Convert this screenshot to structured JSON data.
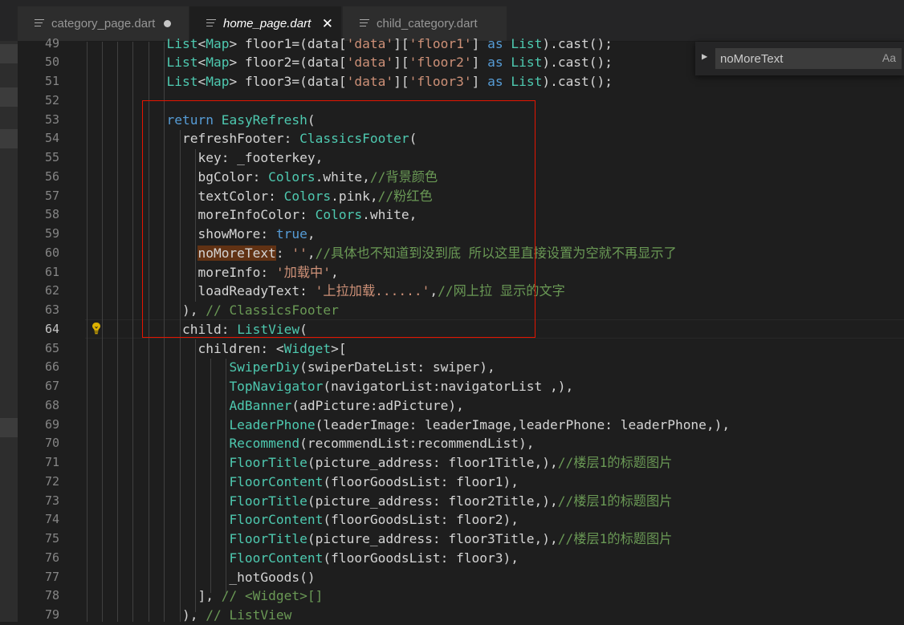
{
  "tabs": [
    {
      "label": "category_page.dart",
      "icon": "file-lines-icon",
      "dirty": true
    },
    {
      "label": "home_page.dart",
      "icon": "file-lines-icon",
      "active": true,
      "close": "✕"
    },
    {
      "label": "child_category.dart",
      "icon": "file-lines-icon"
    }
  ],
  "find_widget": {
    "value": "noMoreText",
    "match_case_label": "Aa",
    "toggle_icon": "chevron-right-icon"
  },
  "lightbulb_icon": "lightbulb-icon",
  "current_line": 64,
  "colors": {
    "keyword": "#569cd6",
    "type": "#4ec9b0",
    "string": "#ce9178",
    "comment": "#6a9955",
    "highlight": "#613214",
    "annotation_box": "#e51400"
  },
  "code": {
    "lines": [
      {
        "n": "49",
        "tokens": [
          {
            "t": "List",
            "c": "ty"
          },
          {
            "t": "<",
            "c": "id"
          },
          {
            "t": "Map",
            "c": "ty"
          },
          {
            "t": "> floor1=(data[",
            "c": "id"
          },
          {
            "t": "'data'",
            "c": "str"
          },
          {
            "t": "][",
            "c": "id"
          },
          {
            "t": "'floor1'",
            "c": "str"
          },
          {
            "t": "] ",
            "c": "id"
          },
          {
            "t": "as",
            "c": "kw"
          },
          {
            "t": " ",
            "c": "id"
          },
          {
            "t": "List",
            "c": "ty"
          },
          {
            "t": ").cast();",
            "c": "id"
          }
        ]
      },
      {
        "n": "50",
        "tokens": [
          {
            "t": "List",
            "c": "ty"
          },
          {
            "t": "<",
            "c": "id"
          },
          {
            "t": "Map",
            "c": "ty"
          },
          {
            "t": "> floor2=(data[",
            "c": "id"
          },
          {
            "t": "'data'",
            "c": "str"
          },
          {
            "t": "][",
            "c": "id"
          },
          {
            "t": "'floor2'",
            "c": "str"
          },
          {
            "t": "] ",
            "c": "id"
          },
          {
            "t": "as",
            "c": "kw"
          },
          {
            "t": " ",
            "c": "id"
          },
          {
            "t": "List",
            "c": "ty"
          },
          {
            "t": ").cast();",
            "c": "id"
          }
        ]
      },
      {
        "n": "51",
        "tokens": [
          {
            "t": "List",
            "c": "ty"
          },
          {
            "t": "<",
            "c": "id"
          },
          {
            "t": "Map",
            "c": "ty"
          },
          {
            "t": "> floor3=(data[",
            "c": "id"
          },
          {
            "t": "'data'",
            "c": "str"
          },
          {
            "t": "][",
            "c": "id"
          },
          {
            "t": "'floor3'",
            "c": "str"
          },
          {
            "t": "] ",
            "c": "id"
          },
          {
            "t": "as",
            "c": "kw"
          },
          {
            "t": " ",
            "c": "id"
          },
          {
            "t": "List",
            "c": "ty"
          },
          {
            "t": ").cast();",
            "c": "id"
          }
        ]
      },
      {
        "n": "52",
        "tokens": []
      },
      {
        "n": "53",
        "tokens": [
          {
            "t": "return",
            "c": "kw"
          },
          {
            "t": " ",
            "c": "id"
          },
          {
            "t": "EasyRefresh",
            "c": "ty"
          },
          {
            "t": "(",
            "c": "id"
          }
        ]
      },
      {
        "n": "54",
        "tokens": [
          {
            "t": "  refreshFooter: ",
            "c": "id"
          },
          {
            "t": "ClassicsFooter",
            "c": "ty"
          },
          {
            "t": "(",
            "c": "id"
          }
        ]
      },
      {
        "n": "55",
        "tokens": [
          {
            "t": "    key: _footerkey,",
            "c": "id"
          }
        ]
      },
      {
        "n": "56",
        "tokens": [
          {
            "t": "    bgColor: ",
            "c": "id"
          },
          {
            "t": "Colors",
            "c": "ty"
          },
          {
            "t": ".white,",
            "c": "id"
          },
          {
            "t": "//背景颜色",
            "c": "cm"
          }
        ]
      },
      {
        "n": "57",
        "tokens": [
          {
            "t": "    textColor: ",
            "c": "id"
          },
          {
            "t": "Colors",
            "c": "ty"
          },
          {
            "t": ".pink,",
            "c": "id"
          },
          {
            "t": "//粉红色",
            "c": "cm"
          }
        ]
      },
      {
        "n": "58",
        "tokens": [
          {
            "t": "    moreInfoColor: ",
            "c": "id"
          },
          {
            "t": "Colors",
            "c": "ty"
          },
          {
            "t": ".white,",
            "c": "id"
          }
        ]
      },
      {
        "n": "59",
        "tokens": [
          {
            "t": "    showMore: ",
            "c": "id"
          },
          {
            "t": "true",
            "c": "kw"
          },
          {
            "t": ",",
            "c": "id"
          }
        ]
      },
      {
        "n": "60",
        "tokens": [
          {
            "t": "    ",
            "c": "id"
          },
          {
            "t": "noMoreText",
            "c": "id hl"
          },
          {
            "t": ": ",
            "c": "id"
          },
          {
            "t": "''",
            "c": "str"
          },
          {
            "t": ",",
            "c": "id"
          },
          {
            "t": "//具体也不知道到没到底 所以这里直接设置为空就不再显示了",
            "c": "cm"
          }
        ]
      },
      {
        "n": "61",
        "tokens": [
          {
            "t": "    moreInfo: ",
            "c": "id"
          },
          {
            "t": "'加载中'",
            "c": "str"
          },
          {
            "t": ",",
            "c": "id"
          }
        ]
      },
      {
        "n": "62",
        "tokens": [
          {
            "t": "    loadReadyText: ",
            "c": "id"
          },
          {
            "t": "'上拉加载......'",
            "c": "str"
          },
          {
            "t": ",",
            "c": "id"
          },
          {
            "t": "//网上拉 显示的文字",
            "c": "cm"
          }
        ]
      },
      {
        "n": "63",
        "tokens": [
          {
            "t": "  ), ",
            "c": "id"
          },
          {
            "t": "// ClassicsFooter",
            "c": "cm"
          }
        ]
      },
      {
        "n": "64",
        "tokens": [
          {
            "t": "  child: ",
            "c": "id"
          },
          {
            "t": "ListView",
            "c": "ty"
          },
          {
            "t": "(",
            "c": "id"
          }
        ]
      },
      {
        "n": "65",
        "tokens": [
          {
            "t": "    children: <",
            "c": "id"
          },
          {
            "t": "Widget",
            "c": "ty"
          },
          {
            "t": ">[",
            "c": "id"
          }
        ]
      },
      {
        "n": "66",
        "tokens": [
          {
            "t": "        ",
            "c": "id"
          },
          {
            "t": "SwiperDiy",
            "c": "ty"
          },
          {
            "t": "(swiperDateList: swiper),",
            "c": "id"
          }
        ]
      },
      {
        "n": "67",
        "tokens": [
          {
            "t": "        ",
            "c": "id"
          },
          {
            "t": "TopNavigator",
            "c": "ty"
          },
          {
            "t": "(navigatorList:navigatorList ,),",
            "c": "id"
          }
        ]
      },
      {
        "n": "68",
        "tokens": [
          {
            "t": "        ",
            "c": "id"
          },
          {
            "t": "AdBanner",
            "c": "ty"
          },
          {
            "t": "(adPicture:adPicture),",
            "c": "id"
          }
        ]
      },
      {
        "n": "69",
        "tokens": [
          {
            "t": "        ",
            "c": "id"
          },
          {
            "t": "LeaderPhone",
            "c": "ty"
          },
          {
            "t": "(leaderImage: leaderImage,leaderPhone: leaderPhone,),",
            "c": "id"
          }
        ]
      },
      {
        "n": "70",
        "tokens": [
          {
            "t": "        ",
            "c": "id"
          },
          {
            "t": "Recommend",
            "c": "ty"
          },
          {
            "t": "(recommendList:recommendList),",
            "c": "id"
          }
        ]
      },
      {
        "n": "71",
        "tokens": [
          {
            "t": "        ",
            "c": "id"
          },
          {
            "t": "FloorTitle",
            "c": "ty"
          },
          {
            "t": "(picture_address: floor1Title,),",
            "c": "id"
          },
          {
            "t": "//楼层1的标题图片",
            "c": "cm"
          }
        ]
      },
      {
        "n": "72",
        "tokens": [
          {
            "t": "        ",
            "c": "id"
          },
          {
            "t": "FloorContent",
            "c": "ty"
          },
          {
            "t": "(floorGoodsList: floor1),",
            "c": "id"
          }
        ]
      },
      {
        "n": "73",
        "tokens": [
          {
            "t": "        ",
            "c": "id"
          },
          {
            "t": "FloorTitle",
            "c": "ty"
          },
          {
            "t": "(picture_address: floor2Title,),",
            "c": "id"
          },
          {
            "t": "//楼层1的标题图片",
            "c": "cm"
          }
        ]
      },
      {
        "n": "74",
        "tokens": [
          {
            "t": "        ",
            "c": "id"
          },
          {
            "t": "FloorContent",
            "c": "ty"
          },
          {
            "t": "(floorGoodsList: floor2),",
            "c": "id"
          }
        ]
      },
      {
        "n": "75",
        "tokens": [
          {
            "t": "        ",
            "c": "id"
          },
          {
            "t": "FloorTitle",
            "c": "ty"
          },
          {
            "t": "(picture_address: floor3Title,),",
            "c": "id"
          },
          {
            "t": "//楼层1的标题图片",
            "c": "cm"
          }
        ]
      },
      {
        "n": "76",
        "tokens": [
          {
            "t": "        ",
            "c": "id"
          },
          {
            "t": "FloorContent",
            "c": "ty"
          },
          {
            "t": "(floorGoodsList: floor3),",
            "c": "id"
          }
        ]
      },
      {
        "n": "77",
        "tokens": [
          {
            "t": "        _hotGoods()",
            "c": "id"
          }
        ]
      },
      {
        "n": "78",
        "tokens": [
          {
            "t": "    ], ",
            "c": "id"
          },
          {
            "t": "// <Widget>[]",
            "c": "cm"
          }
        ]
      },
      {
        "n": "79",
        "tokens": [
          {
            "t": "  ), ",
            "c": "id"
          },
          {
            "t": "// ListView",
            "c": "cm"
          }
        ]
      }
    ]
  }
}
